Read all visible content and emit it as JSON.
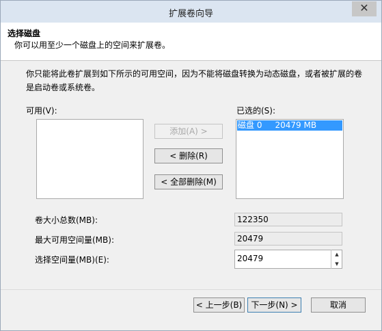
{
  "window": {
    "title": "扩展卷向导",
    "close_glyph": "✕"
  },
  "header": {
    "title": "选择磁盘",
    "subtitle": "你可以用至少一个磁盘上的空间来扩展卷。"
  },
  "description": {
    "line1": "你只能将此卷扩展到如下所示的可用空间，因为不能将磁盘转换为动态磁盘，或者被扩展的卷",
    "line2": "是启动卷或系统卷。"
  },
  "available": {
    "label": "可用(V):",
    "items": []
  },
  "selected": {
    "label": "已选的(S):",
    "items": [
      {
        "text": "磁盘 0     20479 MB"
      }
    ]
  },
  "buttons": {
    "add": "添加(A) >",
    "remove": "< 删除(R)",
    "remove_all": "< 全部删除(M)",
    "back": "< 上一步(B)",
    "next": "下一步(N) >",
    "cancel": "取消"
  },
  "fields": {
    "total_label": "卷大小总数(MB):",
    "total_value": "122350",
    "max_label": "最大可用空间量(MB):",
    "max_value": "20479",
    "select_label": "选择空间量(MB)(E):",
    "select_value": "20479"
  },
  "spinner": {
    "up": "▲",
    "down": "▼"
  }
}
